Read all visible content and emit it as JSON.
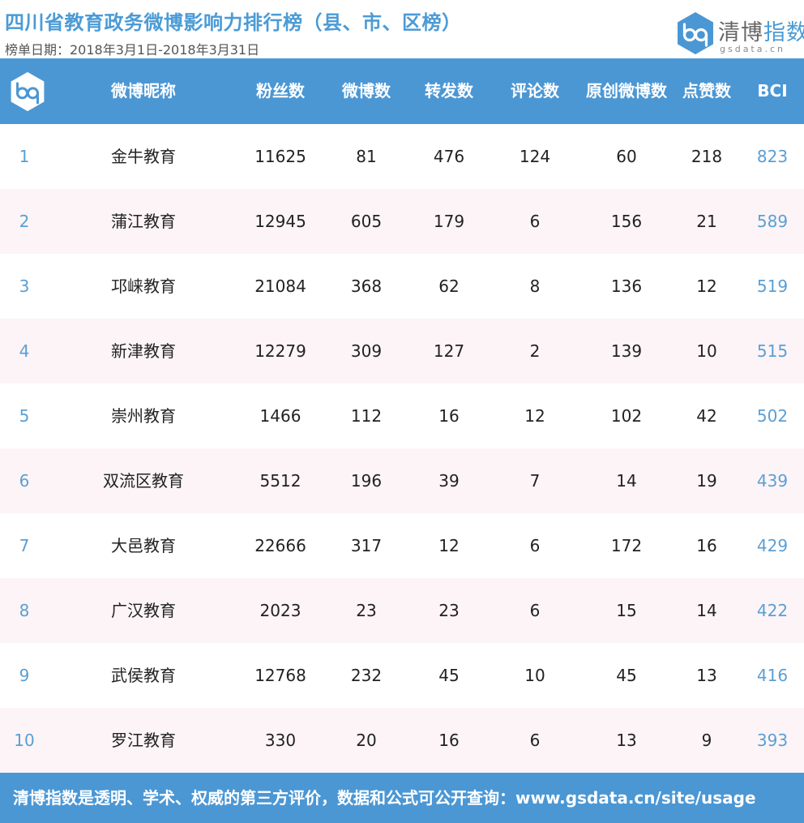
{
  "header": {
    "title": "四川省教育政务微博影响力排行榜（县、市、区榜）",
    "date_range": "榜单日期：2018年3月1日-2018年3月31日"
  },
  "brand": {
    "name_part1": "清博",
    "name_part2": "指数",
    "url": "gsdata.cn",
    "icon": "gsdata-logo-icon",
    "accent_color": "#4b97d4"
  },
  "table": {
    "columns": [
      "微博昵称",
      "粉丝数",
      "微博数",
      "转发数",
      "评论数",
      "原创微博数",
      "点赞数",
      "BCI"
    ],
    "rows": [
      {
        "rank": "1",
        "name": "金牛教育",
        "fans": "11625",
        "weibo": "81",
        "forward": "476",
        "comment": "124",
        "original": "60",
        "like": "218",
        "bci": "823"
      },
      {
        "rank": "2",
        "name": "蒲江教育",
        "fans": "12945",
        "weibo": "605",
        "forward": "179",
        "comment": "6",
        "original": "156",
        "like": "21",
        "bci": "589"
      },
      {
        "rank": "3",
        "name": "邛崃教育",
        "fans": "21084",
        "weibo": "368",
        "forward": "62",
        "comment": "8",
        "original": "136",
        "like": "12",
        "bci": "519"
      },
      {
        "rank": "4",
        "name": "新津教育",
        "fans": "12279",
        "weibo": "309",
        "forward": "127",
        "comment": "2",
        "original": "139",
        "like": "10",
        "bci": "515"
      },
      {
        "rank": "5",
        "name": "崇州教育",
        "fans": "1466",
        "weibo": "112",
        "forward": "16",
        "comment": "12",
        "original": "102",
        "like": "42",
        "bci": "502"
      },
      {
        "rank": "6",
        "name": "双流区教育",
        "fans": "5512",
        "weibo": "196",
        "forward": "39",
        "comment": "7",
        "original": "14",
        "like": "19",
        "bci": "439"
      },
      {
        "rank": "7",
        "name": "大邑教育",
        "fans": "22666",
        "weibo": "317",
        "forward": "12",
        "comment": "6",
        "original": "172",
        "like": "16",
        "bci": "429"
      },
      {
        "rank": "8",
        "name": "广汉教育",
        "fans": "2023",
        "weibo": "23",
        "forward": "23",
        "comment": "6",
        "original": "15",
        "like": "14",
        "bci": "422"
      },
      {
        "rank": "9",
        "name": "武侯教育",
        "fans": "12768",
        "weibo": "232",
        "forward": "45",
        "comment": "10",
        "original": "45",
        "like": "13",
        "bci": "416"
      },
      {
        "rank": "10",
        "name": "罗江教育",
        "fans": "330",
        "weibo": "20",
        "forward": "16",
        "comment": "6",
        "original": "13",
        "like": "9",
        "bci": "393"
      }
    ]
  },
  "footer": {
    "text": "清博指数是透明、学术、权威的第三方评价，数据和公式可公开查询：www.gsdata.cn/site/usage"
  }
}
